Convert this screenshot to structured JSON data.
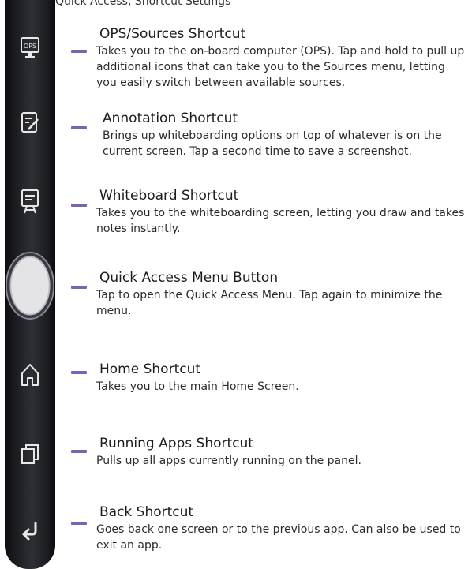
{
  "top_caption": "Quick Access, Shortcut Settings",
  "sidebar_icons": [
    {
      "name": "ops-icon",
      "text": "OPS"
    },
    {
      "name": "annotation-icon"
    },
    {
      "name": "whiteboard-icon"
    },
    {
      "name": "quick-access-circle-icon"
    },
    {
      "name": "home-icon"
    },
    {
      "name": "running-apps-icon"
    },
    {
      "name": "back-arrow-icon"
    }
  ],
  "entries": [
    {
      "title": "OPS/Sources Shortcut",
      "desc": "Takes you to the on-board computer (OPS). Tap and hold to pull up additional icons that can take you to the Sources menu, letting you easily switch between available sources."
    },
    {
      "title": "Annotation Shortcut",
      "desc": "Brings up whiteboarding options on top of whatever is on the current screen. Tap a second time to save a screenshot."
    },
    {
      "title": "Whiteboard Shortcut",
      "desc": "Takes you to the whiteboarding screen, letting you draw and takes notes instantly."
    },
    {
      "title": "Quick Access Menu Button",
      "desc": "Tap to open the Quick Access Menu. Tap again to minimize the menu."
    },
    {
      "title": "Home Shortcut",
      "desc": "Takes you to the main Home Screen."
    },
    {
      "title": "Running Apps Shortcut",
      "desc": "Pulls up all apps currently running on the panel."
    },
    {
      "title": "Back Shortcut",
      "desc": "Goes back one screen or to the previous app. Can also be used to exit an app."
    }
  ],
  "colors": {
    "accent_dash": "#7b62b5",
    "sidebar_bg": "#26272c"
  }
}
